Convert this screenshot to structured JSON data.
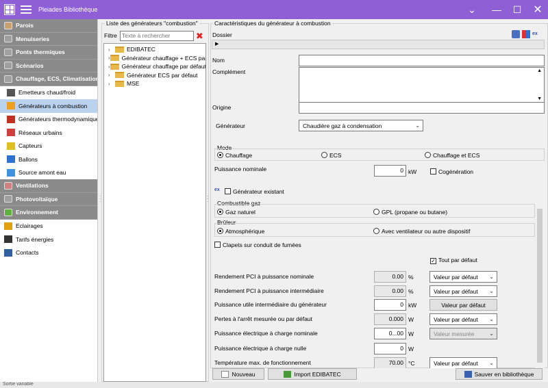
{
  "window": {
    "title": "Pleiades Bibliothèque"
  },
  "nav": {
    "items": [
      {
        "label": "Parois",
        "type": "cat",
        "icon": "wall-icon",
        "color": "#c9a070"
      },
      {
        "label": "Menuiseries",
        "type": "cat",
        "icon": "window-icon",
        "color": "#a0a0a0"
      },
      {
        "label": "Ponts thermiques",
        "type": "cat",
        "icon": "thermal-bridge-icon",
        "color": "#a0a0a0"
      },
      {
        "label": "Scénarios",
        "type": "cat",
        "icon": "scenario-icon",
        "color": "#a0a0a0"
      },
      {
        "label": "Chauffage, ECS, Climatisation",
        "type": "cat",
        "icon": "heating-icon",
        "color": "#a0a0a0"
      },
      {
        "label": "Emetteurs chaud/froid",
        "type": "sub",
        "icon": "radiator-icon",
        "color": "#555555"
      },
      {
        "label": "Générateurs à combustion",
        "type": "sub",
        "icon": "flame-icon",
        "color": "#f0a020",
        "selected": true
      },
      {
        "label": "Générateurs thermodynamiques",
        "type": "sub",
        "icon": "heat-pump-icon",
        "color": "#c03020"
      },
      {
        "label": "Réseaux urbains",
        "type": "sub",
        "icon": "network-icon",
        "color": "#d04040"
      },
      {
        "label": "Capteurs",
        "type": "sub",
        "icon": "solar-collector-icon",
        "color": "#e0c020"
      },
      {
        "label": "Ballons",
        "type": "sub",
        "icon": "tank-icon",
        "color": "#3070d0"
      },
      {
        "label": "Source amont eau",
        "type": "sub",
        "icon": "water-drop-icon",
        "color": "#4090e0"
      },
      {
        "label": "Ventilations",
        "type": "cat",
        "icon": "fan-icon",
        "color": "#d08080"
      },
      {
        "label": "Photovoltaïque",
        "type": "cat",
        "icon": "pv-panel-icon",
        "color": "#a0a0a0"
      },
      {
        "label": "Environnement",
        "type": "cat",
        "icon": "leaf-icon",
        "color": "#60b040"
      },
      {
        "label": "Eclairages",
        "type": "plain",
        "icon": "lighting-icon",
        "color": "#e0a010"
      },
      {
        "label": "Tarifs énergies",
        "type": "plain",
        "icon": "energy-flame-icon",
        "color": "#333333"
      },
      {
        "label": "Contacts",
        "type": "plain",
        "icon": "contacts-icon",
        "color": "#3060a0"
      }
    ]
  },
  "tree_panel": {
    "title": "Liste des générateurs \"combustion\"",
    "filter_label": "Filtre",
    "filter_placeholder": "Texte à rechercher",
    "items": [
      "EDIBATEC",
      "Générateur chauffage + ECS par défaut",
      "Générateur chauffage par défaut",
      "Générateur ECS par défaut",
      "MSE"
    ]
  },
  "form": {
    "title": "Caractéristiques du générateur à combustion",
    "dossier_label": "Dossier",
    "nom_label": "Nom",
    "nom_value": "",
    "complement_label": "Complément",
    "complement_value": "",
    "origine_label": "Origine",
    "origine_value": "",
    "generateur_label": "Générateur",
    "generateur_value": "Chaudière gaz à condensation",
    "mode_title": "Mode",
    "mode_options": [
      "Chauffage",
      "ECS",
      "Chauffage et ECS"
    ],
    "mode_selected": 0,
    "puissance_nominale_label": "Puissance nominale",
    "puissance_nominale_value": "0",
    "puissance_nominale_unit": "kW",
    "cogeneration_label": "Cogénération",
    "generateur_existant_label": "Générateur existant",
    "combustible_title": "Combustible gaz",
    "combustible_options": [
      "Gaz naturel",
      "GPL (propane ou butane)"
    ],
    "combustible_selected": 0,
    "bruleur_title": "Brûleur",
    "bruleur_options": [
      "Atmosphérique",
      "Avec ventilateur ou autre dispositif"
    ],
    "bruleur_selected": 0,
    "clapets_label": "Clapets sur conduit de fumées",
    "tout_par_defaut_label": "Tout par défaut",
    "rows": [
      {
        "label": "Rendement PCI à puissance nominale",
        "value": "0.00",
        "unit": "%",
        "action": "Valeur par défaut",
        "action_type": "combo",
        "readonly": true
      },
      {
        "label": "Rendement PCI à puissance intermédiaire",
        "value": "0.00",
        "unit": "%",
        "action": "Valeur par défaut",
        "action_type": "combo",
        "readonly": true
      },
      {
        "label": "Puissance utile intermédiaire du générateur",
        "value": "0",
        "unit": "kW",
        "action": "Valeur par défaut",
        "action_type": "button",
        "readonly": false
      },
      {
        "label": "Pertes à l'arrêt mesurée ou par défaut",
        "value": "0.000",
        "unit": "W",
        "action": "Valeur par défaut",
        "action_type": "combo",
        "readonly": true
      },
      {
        "label": "Puissance électrique à charge nominale",
        "value": "0...00",
        "unit": "W",
        "action": "Valeur mesurée",
        "action_type": "combo-disabled",
        "readonly": false
      },
      {
        "label": "Puissance électrique à charge nulle",
        "value": "0",
        "unit": "W",
        "action": "",
        "action_type": "none",
        "readonly": false
      },
      {
        "label": "Température max. de fonctionnement",
        "value": "70.00",
        "unit": "°C",
        "action": "Valeur par défaut",
        "action_type": "combo",
        "readonly": true
      }
    ],
    "buttons": {
      "nouveau": "Nouveau",
      "import": "Import EDIBATEC",
      "sauver": "Sauver en bibliothèque"
    }
  },
  "status_text": "Sortie variable"
}
